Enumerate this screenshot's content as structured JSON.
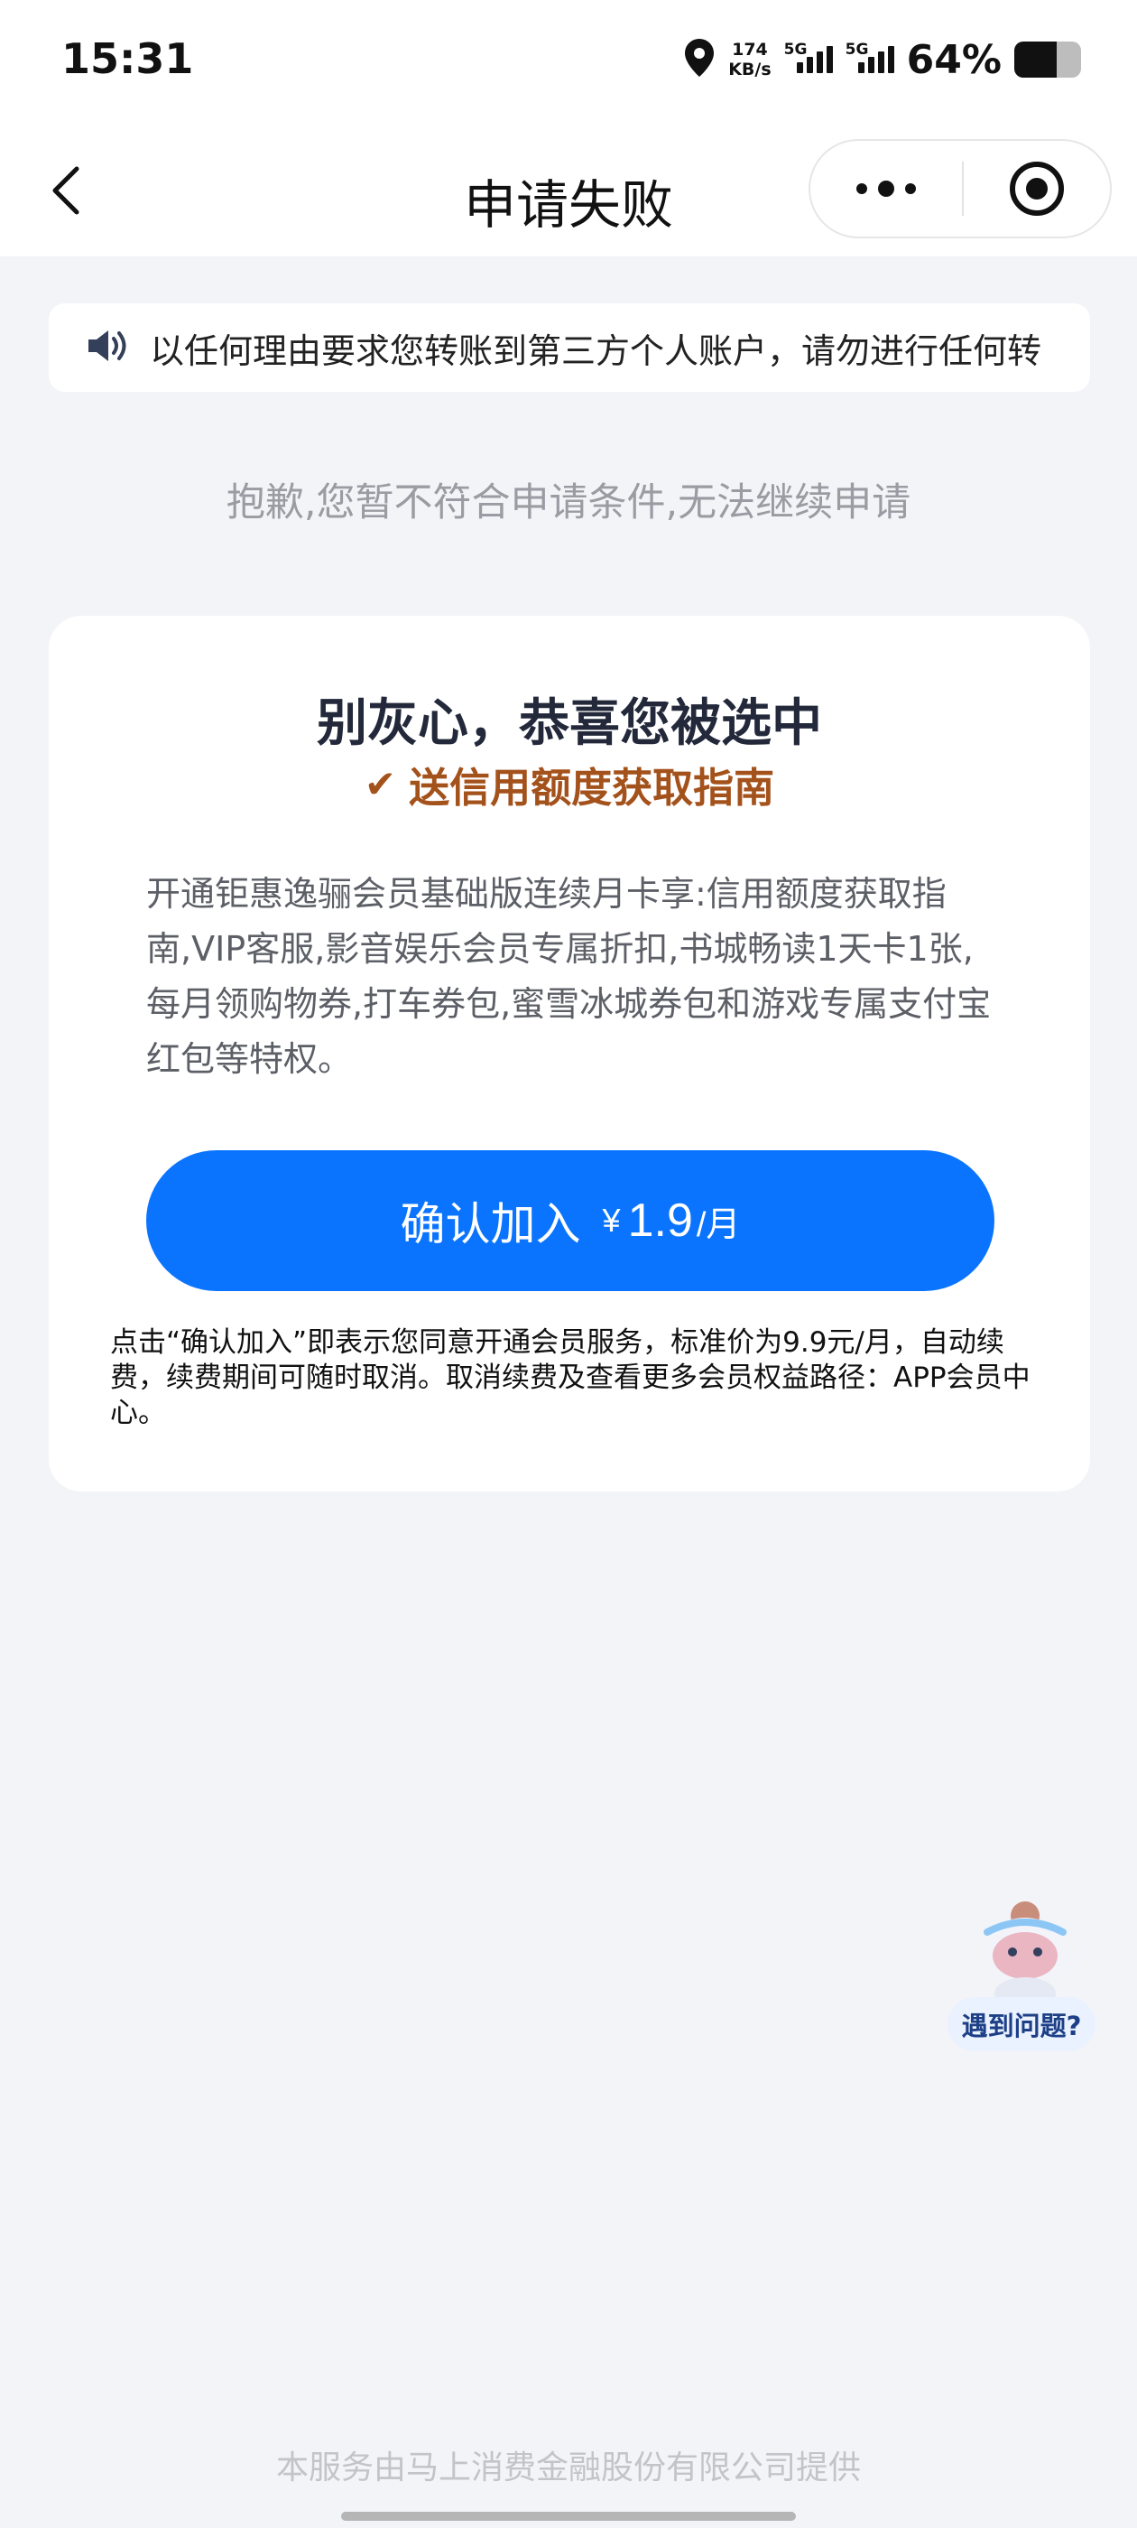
{
  "status_bar": {
    "time": "15:31",
    "net_speed_value": "174",
    "net_speed_unit": "KB/s",
    "sim1_label": "5G",
    "sim2_label": "5G",
    "battery_percent_text": "64%",
    "battery_level": 0.64,
    "icons": [
      "location-icon",
      "signal-icon",
      "battery-icon"
    ]
  },
  "nav": {
    "title": "申请失败",
    "icons": [
      "back-icon",
      "more-icon",
      "close-mini-program-icon"
    ]
  },
  "notice": {
    "icon": "speaker-icon",
    "text": "以任何理由要求您转账到第三方个人账户，请勿进行任何转"
  },
  "sorry_message": "抱歉,您暂不符合申请条件,无法继续申请",
  "card": {
    "title": "别灰心，恭喜您被选中",
    "subtitle_icon": "check-icon",
    "subtitle": "送信用额度获取指南",
    "description": "开通钜惠逸骊会员基础版连续月卡享:信用额度获取指南,VIP客服,影音娱乐会员专属折扣,书城畅读1天卡1张,每月领购物券,打车券包,蜜雪冰城券包和游戏专属支付宝红包等特权。",
    "button": {
      "label": "确认加入",
      "currency": "¥",
      "price": "1.9",
      "unit": "/月"
    },
    "terms": "点击“确认加入”即表示您同意开通会员服务，标准价为9.9元/月，自动续费，续费期间可随时取消。取消续费及查看更多会员权益路径：APP会员中心。"
  },
  "help": {
    "label": "遇到问题?",
    "icon": "mascot-icon"
  },
  "footer": "本服务由马上消费金融股份有限公司提供",
  "colors": {
    "primary": "#0a74ff",
    "accent_brown": "#a4521b",
    "background": "#f3f4f7"
  }
}
